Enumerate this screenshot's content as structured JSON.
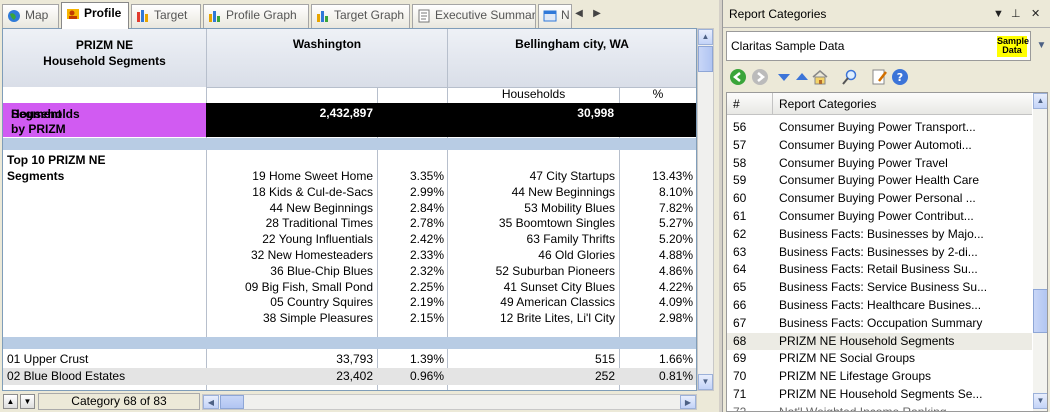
{
  "tabs": [
    {
      "label": "Map",
      "icon": "globe-icon"
    },
    {
      "label": "Profile",
      "icon": "profile-icon",
      "active": true
    },
    {
      "label": "Target",
      "icon": "target-icon"
    },
    {
      "label": "Profile Graph",
      "icon": "bar-chart-icon"
    },
    {
      "label": "Target Graph",
      "icon": "bar-chart-icon"
    },
    {
      "label": "Executive Summary",
      "icon": "document-icon"
    },
    {
      "label": "N",
      "icon": "window-icon"
    }
  ],
  "grid": {
    "header": {
      "segments_title_line1": "PRIZM NE",
      "segments_title_line2": "Household Segments",
      "col1": "Washington",
      "col2": "Bellingham city, WA",
      "sub_households": "Households",
      "sub_pct": "%"
    },
    "households_row": {
      "label_line1": "Households by PRIZM NE",
      "label_line2": "Segment",
      "wa_value": "2,432,897",
      "bel_value": "30,998"
    },
    "top10": {
      "label_line1": "Top 10 PRIZM NE",
      "label_line2": "Segments",
      "wa_names": [
        "19 Home Sweet Home",
        "18 Kids & Cul-de-Sacs",
        "44 New Beginnings",
        "28 Traditional Times",
        "22 Young Influentials",
        "32 New Homesteaders",
        "36 Blue-Chip Blues",
        "09 Big Fish, Small Pond",
        "05 Country Squires",
        "38 Simple Pleasures"
      ],
      "wa_pcts": [
        "3.35%",
        "2.99%",
        "2.84%",
        "2.78%",
        "2.42%",
        "2.33%",
        "2.32%",
        "2.25%",
        "2.19%",
        "2.15%"
      ],
      "bel_names": [
        "47 City Startups",
        "44 New Beginnings",
        "53 Mobility Blues",
        "35 Boomtown Singles",
        "63 Family Thrifts",
        "46 Old Glories",
        "52 Suburban Pioneers",
        "41 Sunset City Blues",
        "49 American Classics",
        "12 Brite Lites, Li'l City"
      ],
      "bel_pcts": [
        "13.43%",
        "8.10%",
        "7.82%",
        "5.27%",
        "5.20%",
        "4.88%",
        "4.86%",
        "4.22%",
        "4.09%",
        "2.98%"
      ]
    },
    "rows": [
      {
        "name": "01 Upper Crust",
        "wa_hh": "33,793",
        "wa_pct": "1.39%",
        "bel_hh": "515",
        "bel_pct": "1.66%"
      },
      {
        "name": "02 Blue Blood Estates",
        "wa_hh": "23,402",
        "wa_pct": "0.96%",
        "bel_hh": "252",
        "bel_pct": "0.81%"
      }
    ]
  },
  "status": {
    "category_label": "Category 68 of 83"
  },
  "panel": {
    "title": "Report Categories",
    "source": "Claritas Sample Data",
    "sample_badge_line1": "Sample",
    "sample_badge_line2": "Data",
    "list_header_num": "#",
    "list_header_label": "Report Categories",
    "items": [
      {
        "num": "56",
        "label": "Consumer Buying Power  Transport..."
      },
      {
        "num": "57",
        "label": "Consumer Buying Power  Automoti..."
      },
      {
        "num": "58",
        "label": "Consumer Buying Power  Travel"
      },
      {
        "num": "59",
        "label": "Consumer Buying Power  Health Care"
      },
      {
        "num": "60",
        "label": "Consumer Buying Power  Personal ..."
      },
      {
        "num": "61",
        "label": "Consumer Buying Power  Contribut..."
      },
      {
        "num": "62",
        "label": "Business Facts:  Businesses by Majo..."
      },
      {
        "num": "63",
        "label": "Business Facts:  Businesses by 2-di..."
      },
      {
        "num": "64",
        "label": "Business Facts:  Retail Business Su..."
      },
      {
        "num": "65",
        "label": "Business Facts:  Service Business Su..."
      },
      {
        "num": "66",
        "label": "Business Facts:  Healthcare Busines..."
      },
      {
        "num": "67",
        "label": "Business Facts:  Occupation Summary"
      },
      {
        "num": "68",
        "label": "PRIZM NE  Household Segments",
        "selected": true
      },
      {
        "num": "69",
        "label": "PRIZM NE  Social Groups"
      },
      {
        "num": "70",
        "label": "PRIZM NE  Lifestage Groups"
      },
      {
        "num": "71",
        "label": "PRIZM NE Household Segments  Se..."
      },
      {
        "num": "72",
        "label": "Nat'l Weighted Income Ranking ..."
      }
    ]
  },
  "colors": {
    "accent_purple": "#d15bf2",
    "band_blue": "#b8cce4",
    "selection": "#ecebe4"
  }
}
